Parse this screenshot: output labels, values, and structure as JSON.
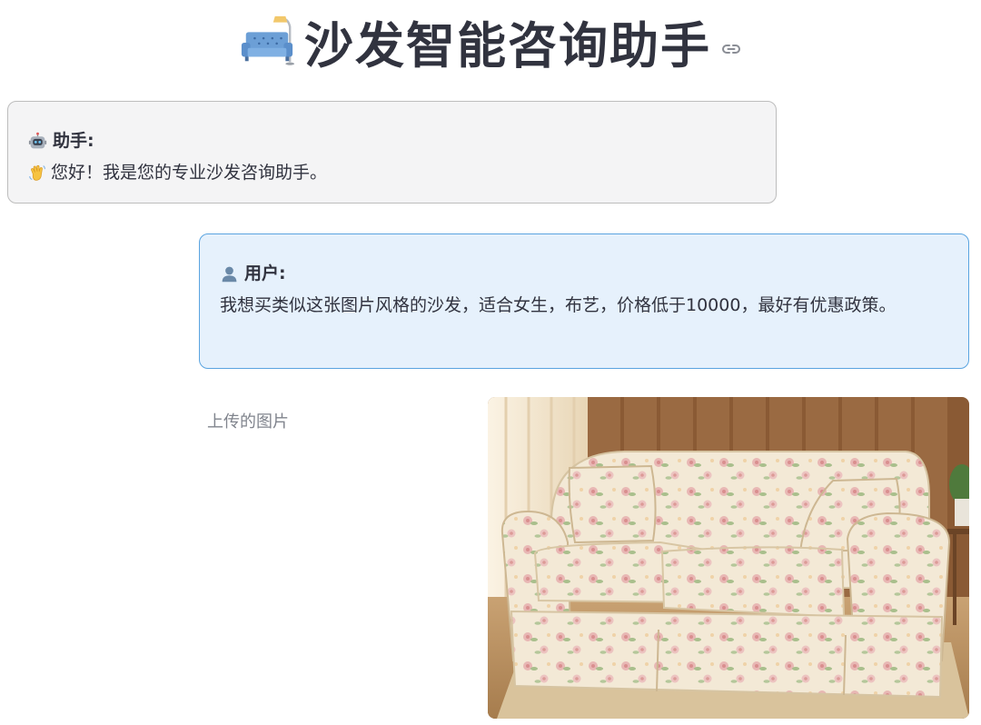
{
  "header": {
    "icon": "couch-and-lamp-icon",
    "title": "沙发智能咨询助手",
    "anchor_icon": "link-icon"
  },
  "messages": [
    {
      "role_icon": "robot-icon",
      "role_label": "助手:",
      "text_icon": "waving-hand-icon",
      "text": "您好！我是您的专业沙发咨询助手。"
    },
    {
      "role_icon": "bust-in-silhouette-icon",
      "role_label": "用户:",
      "text": "我想买类似这张图片风格的沙发，适合女生，布艺，价格低于10000，最好有优惠政策。"
    }
  ],
  "upload": {
    "caption": "上传的图片",
    "image": "floral-loveseat-photo"
  },
  "colors": {
    "assistant_bg": "#f4f4f5",
    "user_bg": "#e6f1fc",
    "user_border": "#5aa4e0",
    "text": "#31333f",
    "caption": "#80848d"
  }
}
